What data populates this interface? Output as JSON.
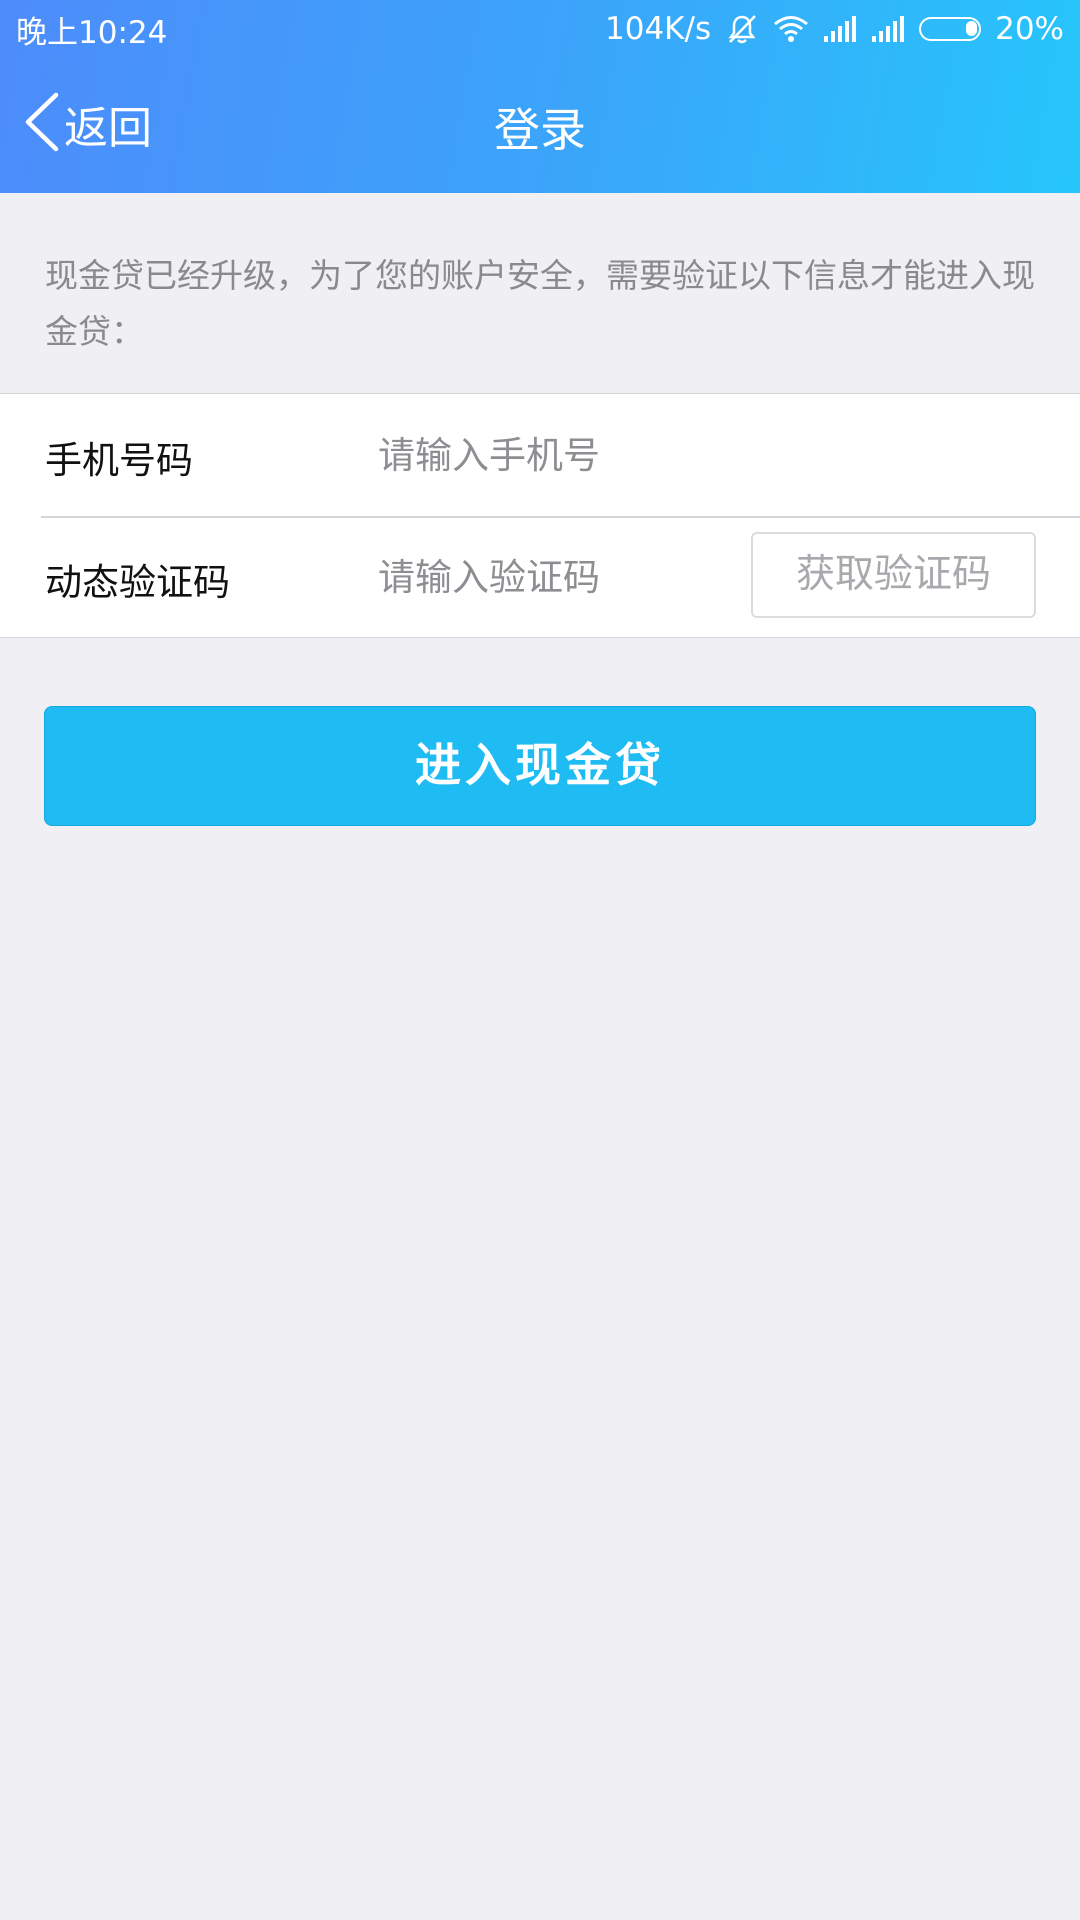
{
  "status_bar": {
    "time": "晚上10:24",
    "net_speed": "104K/s",
    "battery": "20%",
    "battery_level": 0.2
  },
  "nav": {
    "back_label": "返回",
    "title": "登录"
  },
  "notice": "现金贷已经升级，为了您的账户安全，需要验证以下信息才能进入现金贷：",
  "form": {
    "phone_label": "手机号码",
    "phone_placeholder": "请输入手机号",
    "phone_value": "",
    "code_label": "动态验证码",
    "code_placeholder": "请输入验证码",
    "code_value": "",
    "get_code_label": "获取验证码"
  },
  "submit_label": "进入现金贷",
  "colors": {
    "header_start": "#4d8cfb",
    "header_end": "#26c6fb",
    "accent": "#1fbbf3",
    "background": "#efeff4"
  }
}
